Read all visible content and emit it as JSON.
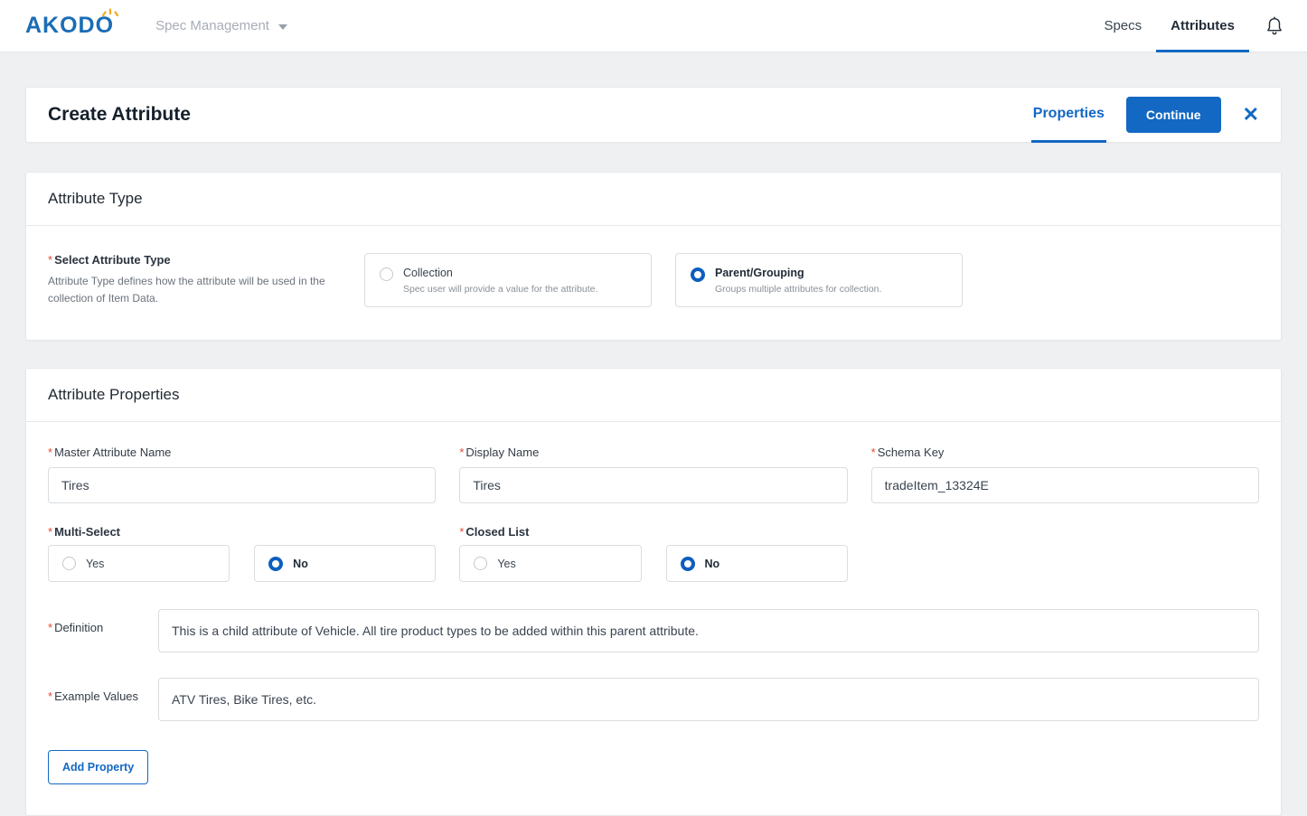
{
  "ui": {
    "required_marker": "*",
    "close_glyph": "✕",
    "accent_color": "#1268c3",
    "required_color": "#e0492f"
  },
  "brand": {
    "name": "AKODO"
  },
  "navbar": {
    "app_menu_label": "Spec Management",
    "links": [
      {
        "label": "Specs",
        "active": false
      },
      {
        "label": "Attributes",
        "active": true
      }
    ]
  },
  "page_header": {
    "title": "Create Attribute",
    "tab_label": "Properties",
    "continue_label": "Continue"
  },
  "attribute_type": {
    "section_title": "Attribute Type",
    "field_label": "Select Attribute Type",
    "field_description": "Attribute Type defines how the attribute will be used in the collection of Item Data.",
    "options": [
      {
        "label": "Collection",
        "description": "Spec user will provide a value for the attribute.",
        "selected": false
      },
      {
        "label": "Parent/Grouping",
        "description": "Groups multiple attributes for collection.",
        "selected": true
      }
    ]
  },
  "attribute_properties": {
    "section_title": "Attribute Properties",
    "master_attribute_name": {
      "label": "Master Attribute Name",
      "value": "Tires"
    },
    "display_name": {
      "label": "Display Name",
      "value": "Tires"
    },
    "schema_key": {
      "label": "Schema Key",
      "value": "tradeItem_13324E"
    },
    "multi_select": {
      "label": "Multi-Select",
      "yes_label": "Yes",
      "no_label": "No",
      "selected": "No"
    },
    "closed_list": {
      "label": "Closed List",
      "yes_label": "Yes",
      "no_label": "No",
      "selected": "No"
    },
    "definition": {
      "label": "Definition",
      "value": "This is a child attribute of Vehicle. All tire product types to be added within this parent attribute."
    },
    "example_values": {
      "label": "Example Values",
      "value": "ATV Tires, Bike Tires, etc."
    },
    "add_property_label": "Add Property"
  }
}
